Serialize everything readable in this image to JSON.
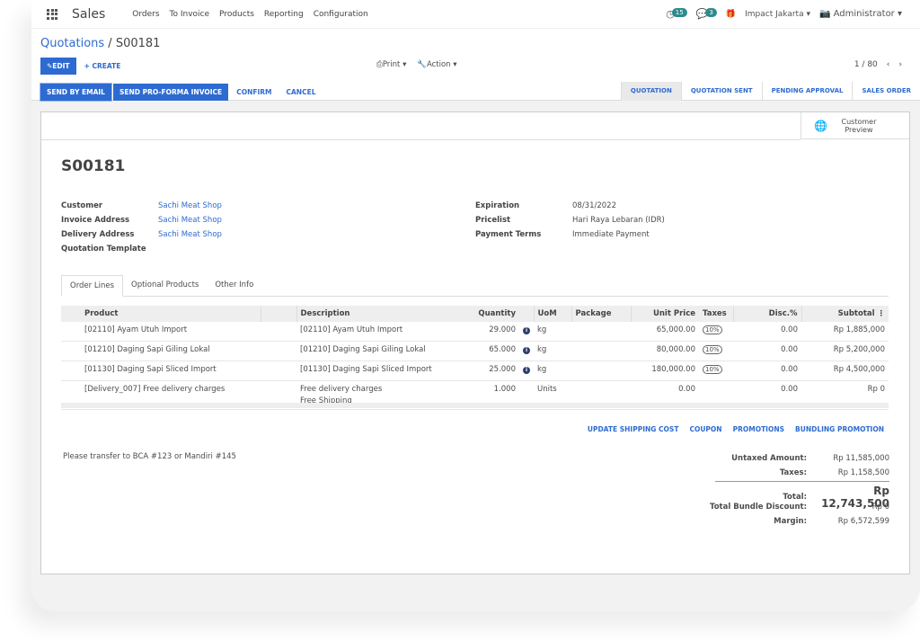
{
  "nav": {
    "app": "Sales",
    "menu": [
      "Orders",
      "To Invoice",
      "Products",
      "Reporting",
      "Configuration"
    ],
    "activity_count": "15",
    "message_count": "3",
    "company": "Impact Jakarta",
    "user": "Administrator"
  },
  "breadcrumb": {
    "parent": "Quotations",
    "current": "S00181"
  },
  "toolbar": {
    "edit": "EDIT",
    "create": "+ CREATE",
    "print": "Print",
    "action": "Action",
    "pager": "1 / 80"
  },
  "actions": {
    "send_email": "SEND BY EMAIL",
    "proforma": "SEND PRO-FORMA INVOICE",
    "confirm": "CONFIRM",
    "cancel": "CANCEL"
  },
  "status": {
    "steps": [
      "QUOTATION",
      "QUOTATION SENT",
      "PENDING APPROVAL",
      "SALES ORDER"
    ],
    "active": "QUOTATION"
  },
  "customer_preview": "Customer Preview",
  "order": {
    "name": "S00181",
    "left": [
      {
        "label": "Customer",
        "value": "Sachi Meat Shop"
      },
      {
        "label": "Invoice Address",
        "value": "Sachi Meat Shop"
      },
      {
        "label": "Delivery Address",
        "value": "Sachi Meat Shop"
      },
      {
        "label": "Quotation Template",
        "value": ""
      }
    ],
    "right": [
      {
        "label": "Expiration",
        "value": "08/31/2022"
      },
      {
        "label": "Pricelist",
        "value": "Hari Raya Lebaran (IDR)"
      },
      {
        "label": "Payment Terms",
        "value": "Immediate Payment"
      }
    ]
  },
  "tabs": [
    "Order Lines",
    "Optional Products",
    "Other Info"
  ],
  "table": {
    "headers": [
      "Product",
      "Description",
      "Quantity",
      "UoM",
      "Package",
      "Unit Price",
      "Taxes",
      "Disc.%",
      "Subtotal"
    ],
    "rows": [
      {
        "product": "[02110] Ayam Utuh Import",
        "desc": "[02110] Ayam Utuh Import",
        "desc2": "",
        "qty": "29.000",
        "uom": "kg",
        "price": "65,000.00",
        "tax": "10%",
        "disc": "0.00",
        "subtotal": "Rp 1,885,000"
      },
      {
        "product": "[01210] Daging Sapi Giling Lokal",
        "desc": "[01210] Daging Sapi Giling Lokal",
        "desc2": "",
        "qty": "65.000",
        "uom": "kg",
        "price": "80,000.00",
        "tax": "10%",
        "disc": "0.00",
        "subtotal": "Rp 5,200,000"
      },
      {
        "product": "[01130] Daging Sapi Sliced Import",
        "desc": "[01130] Daging Sapi Sliced Import",
        "desc2": "",
        "qty": "25.000",
        "uom": "kg",
        "price": "180,000.00",
        "tax": "10%",
        "disc": "0.00",
        "subtotal": "Rp 4,500,000"
      },
      {
        "product": "[Delivery_007] Free delivery charges",
        "desc": "Free delivery charges",
        "desc2": "Free Shipping",
        "qty": "1.000",
        "uom": "Units",
        "price": "0.00",
        "tax": "",
        "disc": "0.00",
        "subtotal": "Rp 0"
      }
    ]
  },
  "line_actions": [
    "UPDATE SHIPPING COST",
    "COUPON",
    "PROMOTIONS",
    "BUNDLING PROMOTION"
  ],
  "note": "Please transfer to BCA #123 or Mandiri #145",
  "totals": [
    {
      "label": "Untaxed Amount:",
      "value": "Rp 11,585,000"
    },
    {
      "label": "Taxes:",
      "value": "Rp 1,158,500"
    },
    {
      "label": "Total:",
      "value": "Rp 12,743,500"
    },
    {
      "label": "Total Bundle Discount:",
      "value": "Rp 0"
    },
    {
      "label": "Margin:",
      "value": "Rp 6,572,599"
    }
  ],
  "colors": {
    "accent": "#2e6bd1",
    "badge": "#2a8c8c"
  }
}
